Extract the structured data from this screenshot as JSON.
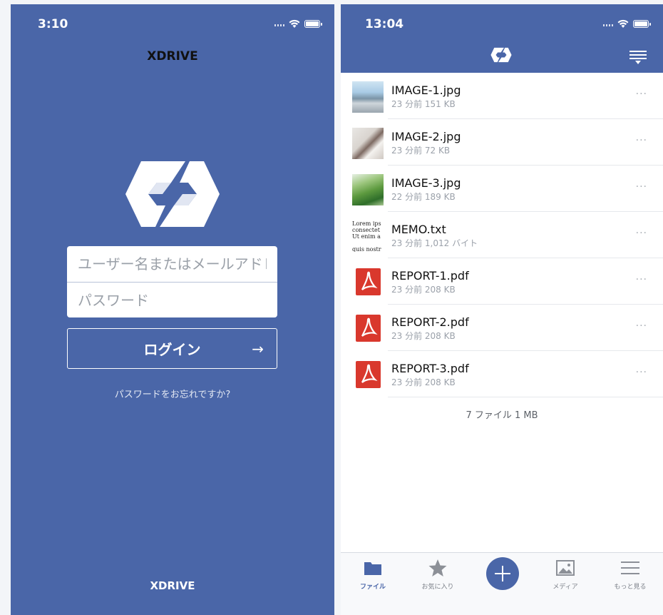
{
  "login": {
    "status_time": "3:10",
    "app_title": "XDRIVE",
    "username_placeholder": "ユーザー名またはメールアドレス",
    "password_placeholder": "パスワード",
    "login_label": "ログイン",
    "login_arrow": "→",
    "forgot_link": "パスワードをお忘れですか?",
    "footer_brand": "XDRIVE"
  },
  "files": {
    "status_time": "13:04",
    "items": [
      {
        "name": "IMAGE-1.jpg",
        "meta": "23 分前 151 KB",
        "type": "image"
      },
      {
        "name": "IMAGE-2.jpg",
        "meta": "23 分前 72 KB",
        "type": "image"
      },
      {
        "name": "IMAGE-3.jpg",
        "meta": "22 分前 189 KB",
        "type": "image"
      },
      {
        "name": "MEMO.txt",
        "meta": "23 分前 1,012 バイト",
        "type": "text"
      },
      {
        "name": "REPORT-1.pdf",
        "meta": "23 分前 208 KB",
        "type": "pdf"
      },
      {
        "name": "REPORT-2.pdf",
        "meta": "23 分前 208 KB",
        "type": "pdf"
      },
      {
        "name": "REPORT-3.pdf",
        "meta": "23 分前 208 KB",
        "type": "pdf"
      }
    ],
    "more_label": "···",
    "memo_preview": [
      "Lorem ips",
      "consectet",
      "Ut enim a",
      "",
      "quis nostr"
    ],
    "summary": "7 ファイル 1 MB",
    "tabs": [
      {
        "label": "ファイル",
        "icon": "folder-icon"
      },
      {
        "label": "お気に入り",
        "icon": "star-icon"
      },
      {
        "label": "メディア",
        "icon": "image-icon"
      },
      {
        "label": "もっと見る",
        "icon": "hamburger-icon"
      }
    ]
  },
  "colors": {
    "brand_blue": "#4a66a8",
    "pdf_red": "#d9382d"
  }
}
